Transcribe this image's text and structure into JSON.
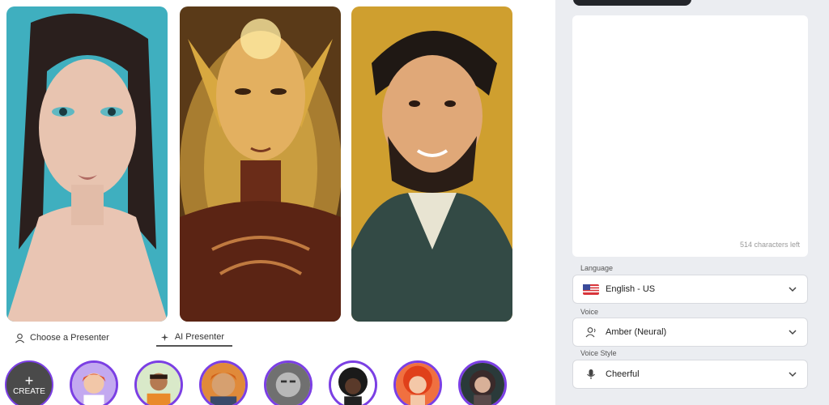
{
  "tabs": {
    "choose_presenter": "Choose a Presenter",
    "ai_presenter": "AI Presenter"
  },
  "create_button": {
    "plus": "+",
    "label": "CREATE"
  },
  "script_box": {
    "char_count": "514 characters left"
  },
  "language": {
    "label": "Language",
    "value": "English - US",
    "icon": "us-flag-icon"
  },
  "voice": {
    "label": "Voice",
    "value": "Amber (Neural)",
    "icon": "person-voice-icon"
  },
  "voice_style": {
    "label": "Voice Style",
    "value": "Cheerful",
    "icon": "microphone-icon"
  },
  "colors": {
    "accent": "#7b3fe4",
    "panel": "#ebedf1",
    "dark": "#23252a"
  }
}
